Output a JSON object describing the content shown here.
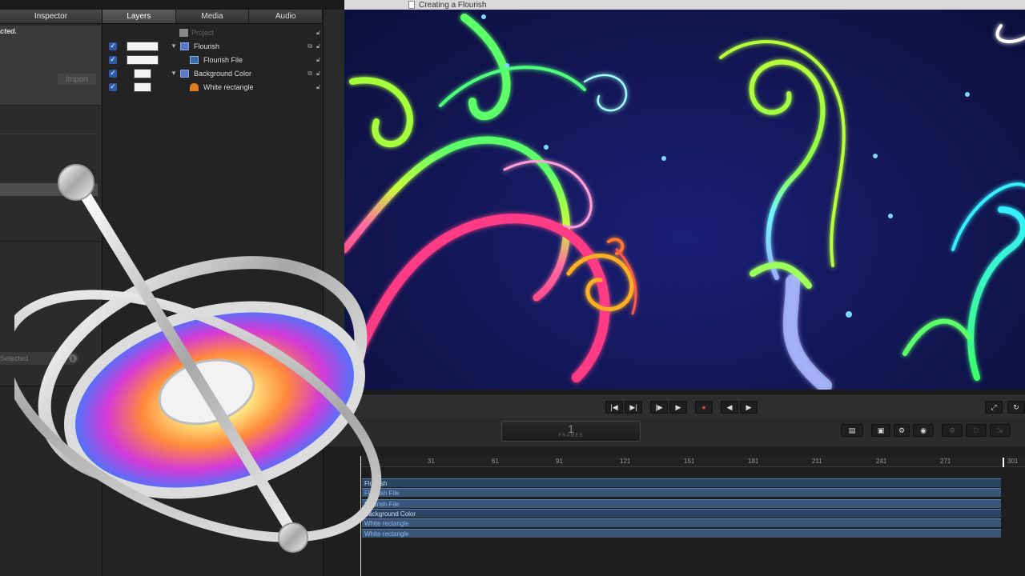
{
  "window": {
    "title": "Creating a Flourish"
  },
  "panels": {
    "inspector_tab": "Inspector",
    "tabs": [
      {
        "label": "Layers",
        "active": true
      },
      {
        "label": "Media",
        "active": false
      },
      {
        "label": "Audio",
        "active": false
      }
    ]
  },
  "inspector": {
    "selection_note": "cted.",
    "import_label": "Import",
    "selected_label": "Selected",
    "info_icon": "i"
  },
  "layers": [
    {
      "name": "Project",
      "type": "project",
      "dim": true
    },
    {
      "name": "Flourish",
      "type": "group",
      "checked": true
    },
    {
      "name": "Flourish File",
      "type": "image",
      "checked": true
    },
    {
      "name": "Background Color",
      "type": "group",
      "checked": true
    },
    {
      "name": "White rectangle",
      "type": "shape",
      "checked": true
    }
  ],
  "timecode": {
    "value": "1",
    "label": "FRAMES"
  },
  "ruler": {
    "ticks": [
      "31",
      "61",
      "91",
      "121",
      "151",
      "181",
      "211",
      "241",
      "271"
    ],
    "end": "301"
  },
  "tracks": [
    {
      "name": "Flourish",
      "group": true
    },
    {
      "name": "Flourish File",
      "group": false
    },
    {
      "name": "Flourish File",
      "group": false
    },
    {
      "name": "Background Color",
      "group": true
    },
    {
      "name": "White rectangle",
      "group": false
    },
    {
      "name": "White rectangle",
      "group": false
    }
  ],
  "colors": {
    "accent": "#2d5ba7",
    "track": "#385577",
    "canvas_bg": "#14185a"
  }
}
